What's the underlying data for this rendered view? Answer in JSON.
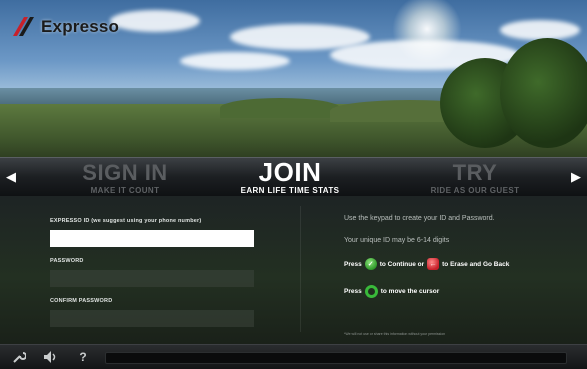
{
  "app": {
    "logo_text": "Expresso"
  },
  "tabs": {
    "sign_in": {
      "title": "SIGN IN",
      "subtitle": "MAKE IT COUNT"
    },
    "join": {
      "title": "JOIN",
      "subtitle": "EARN LIFE TIME STATS"
    },
    "try": {
      "title": "TRY",
      "subtitle": "RIDE AS OUR GUEST"
    }
  },
  "form": {
    "expresso_id_label": "EXPRESSO ID (we suggest using your phone number)",
    "expresso_id_value": "",
    "password_label": "PASSWORD",
    "password_value": "",
    "confirm_password_label": "CONFIRM PASSWORD",
    "confirm_password_value": ""
  },
  "instructions": {
    "line1": "Use the keypad to create your ID and Password.",
    "line2": "Your unique ID may be 6-14 digits",
    "press": "Press",
    "continue_text": "to Continue or",
    "erase_text": "to Erase and Go Back",
    "cursor_text": "to move the cursor",
    "disclaimer": "*We will not use or share this information without your permission"
  },
  "toolbar": {
    "help_label": "?"
  },
  "colors": {
    "accent_green": "#39b93a",
    "erase_red": "#c8202a"
  }
}
